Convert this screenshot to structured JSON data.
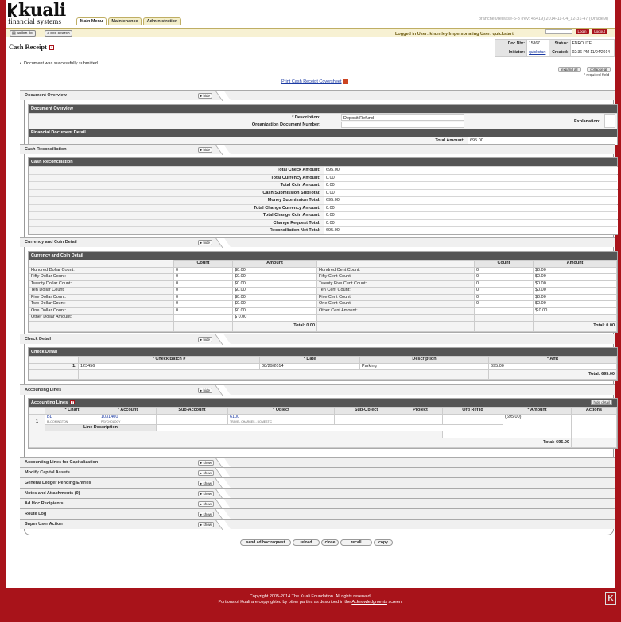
{
  "app": {
    "logo_text": "kuali",
    "logo_sub": "financial systems",
    "build": "branches/release-5-3 (rev: 45419) 2014-11-04_12-31-47 (Oracle9i)"
  },
  "tabs": [
    "Main Menu",
    "Maintenance",
    "Administration"
  ],
  "login": {
    "login_label": "Login",
    "logout_label": "Logout"
  },
  "linkbar": {
    "action_list": "action list",
    "doc_search": "doc search",
    "logged_in": "Logged in User: khuntley   Impersonating User: quickstart"
  },
  "header": {
    "title": "Cash Receipt",
    "doc_nbr_label": "Doc Nbr:",
    "doc_nbr": "15867",
    "status_label": "Status:",
    "status": "ENROUTE",
    "initiator_label": "Initiator:",
    "initiator": "quickstart",
    "created_label": "Created:",
    "created": "02:36 PM 11/04/2014"
  },
  "message": "Document was successfully submitted.",
  "print_link": "Print Cash Receipt Coversheet",
  "expand_all": "expand all",
  "collapse_all": "collapse all",
  "required_note": "* required field",
  "hide": "hide",
  "show": "show",
  "doc_overview": {
    "section": "Document Overview",
    "bar": "Document Overview",
    "desc_label": "* Description:",
    "desc_value": "Deposit Refund",
    "org_label": "Organization Document Number:",
    "expl_label": "Explanation:",
    "fin_bar": "Financial Document Detail",
    "total_label": "Total Amount:",
    "total_value": "695.00"
  },
  "cash_recon": {
    "section": "Cash Reconciliation",
    "bar": "Cash Reconciliation",
    "rows": [
      {
        "label": "Total Check Amount:",
        "value": "695.00"
      },
      {
        "label": "Total Currency Amount:",
        "value": "0.00"
      },
      {
        "label": "Total Coin Amount:",
        "value": "0.00"
      },
      {
        "label": "Cash Submission SubTotal:",
        "value": "0.00"
      },
      {
        "label": "Money Submission Total:",
        "value": "695.00"
      },
      {
        "label": "Total Change Currency Amount:",
        "value": "0.00"
      },
      {
        "label": "Total Change Coin Amount:",
        "value": "0.00"
      },
      {
        "label": "Change Request Total:",
        "value": "0.00"
      },
      {
        "label": "Reconciliation Net Total:",
        "value": "695.00"
      }
    ]
  },
  "currency": {
    "section": "Currency and Coin Detail",
    "bar": "Currency and Coin Detail",
    "count_h": "Count",
    "amount_h": "Amount",
    "left": [
      {
        "label": "Hundred Dollar Count:",
        "count": "0",
        "amount": "$0.00"
      },
      {
        "label": "Fifty Dollar Count:",
        "count": "0",
        "amount": "$0.00"
      },
      {
        "label": "Twenty Dollar Count:",
        "count": "0",
        "amount": "$0.00"
      },
      {
        "label": "Ten Dollar Count:",
        "count": "0",
        "amount": "$0.00"
      },
      {
        "label": "Five Dollar Count:",
        "count": "0",
        "amount": "$0.00"
      },
      {
        "label": "Two Dollar Count:",
        "count": "0",
        "amount": "$0.00"
      },
      {
        "label": "One Dollar Count:",
        "count": "0",
        "amount": "$0.00"
      },
      {
        "label": "Other Dollar Amount:",
        "count": "",
        "amount": "$ 0.00"
      }
    ],
    "right": [
      {
        "label": "Hundred Cent Count:",
        "count": "0",
        "amount": "$0.00"
      },
      {
        "label": "Fifty Cent Count:",
        "count": "0",
        "amount": "$0.00"
      },
      {
        "label": "Twenty Five Cent Count:",
        "count": "0",
        "amount": "$0.00"
      },
      {
        "label": "Ten Cent Count:",
        "count": "0",
        "amount": "$0.00"
      },
      {
        "label": "Five Cent Count:",
        "count": "0",
        "amount": "$0.00"
      },
      {
        "label": "One Cent Count:",
        "count": "0",
        "amount": "$0.00"
      },
      {
        "label": "Other Cent Amount:",
        "count": "",
        "amount": "$ 0.00"
      }
    ],
    "total_left": "Total: 0.00",
    "total_right": "Total: 0.00"
  },
  "check": {
    "section": "Check Detail",
    "bar": "Check Detail",
    "h_check": "* Check/Batch #",
    "h_date": "* Date",
    "h_desc": "Description",
    "h_amt": "* Amt",
    "row_num": "1:",
    "check_no": "123456",
    "date": "08/29/2014",
    "desc": "Parking",
    "amt": "695.00",
    "total": "Total: 695.00"
  },
  "acct": {
    "section": "Accounting Lines",
    "bar": "Accounting Lines",
    "hide_detail": "hide detail",
    "h_chart": "* Chart",
    "h_account": "* Account",
    "h_subaccount": "Sub-Account",
    "h_object": "* Object",
    "h_subobject": "Sub-Object",
    "h_project": "Project",
    "h_orgref": "Org Ref Id",
    "h_amount": "* Amount",
    "h_actions": "Actions",
    "row_num": "1",
    "chart": "BL",
    "chart_sub": "BLOOMINGTON",
    "account": "1031400",
    "account_sub": "PSYCHOLOGY",
    "object": "6100",
    "object_sub": "TRAVEL CHARGES - DOMESTIC",
    "amount": "(695.00)",
    "line_desc": "Line Description",
    "total": "Total: 695.00"
  },
  "collapsed_sections": [
    "Accounting Lines for Capitalization",
    "Modify Capital Assets",
    "General Ledger Pending Entries",
    "Notes and Attachments (0)",
    "Ad Hoc Recipients",
    "Route Log",
    "Super User Action"
  ],
  "buttons": [
    "send ad hoc request",
    "reload",
    "close",
    "recall",
    "copy"
  ],
  "footer": {
    "line1": "Copyright 2005-2014 The Kuali Foundation. All rights reserved.",
    "line2a": "Portions of Kuali are copyrighted by other parties as described in the",
    "line2_link": "Acknowledgments",
    "line2b": "screen."
  }
}
